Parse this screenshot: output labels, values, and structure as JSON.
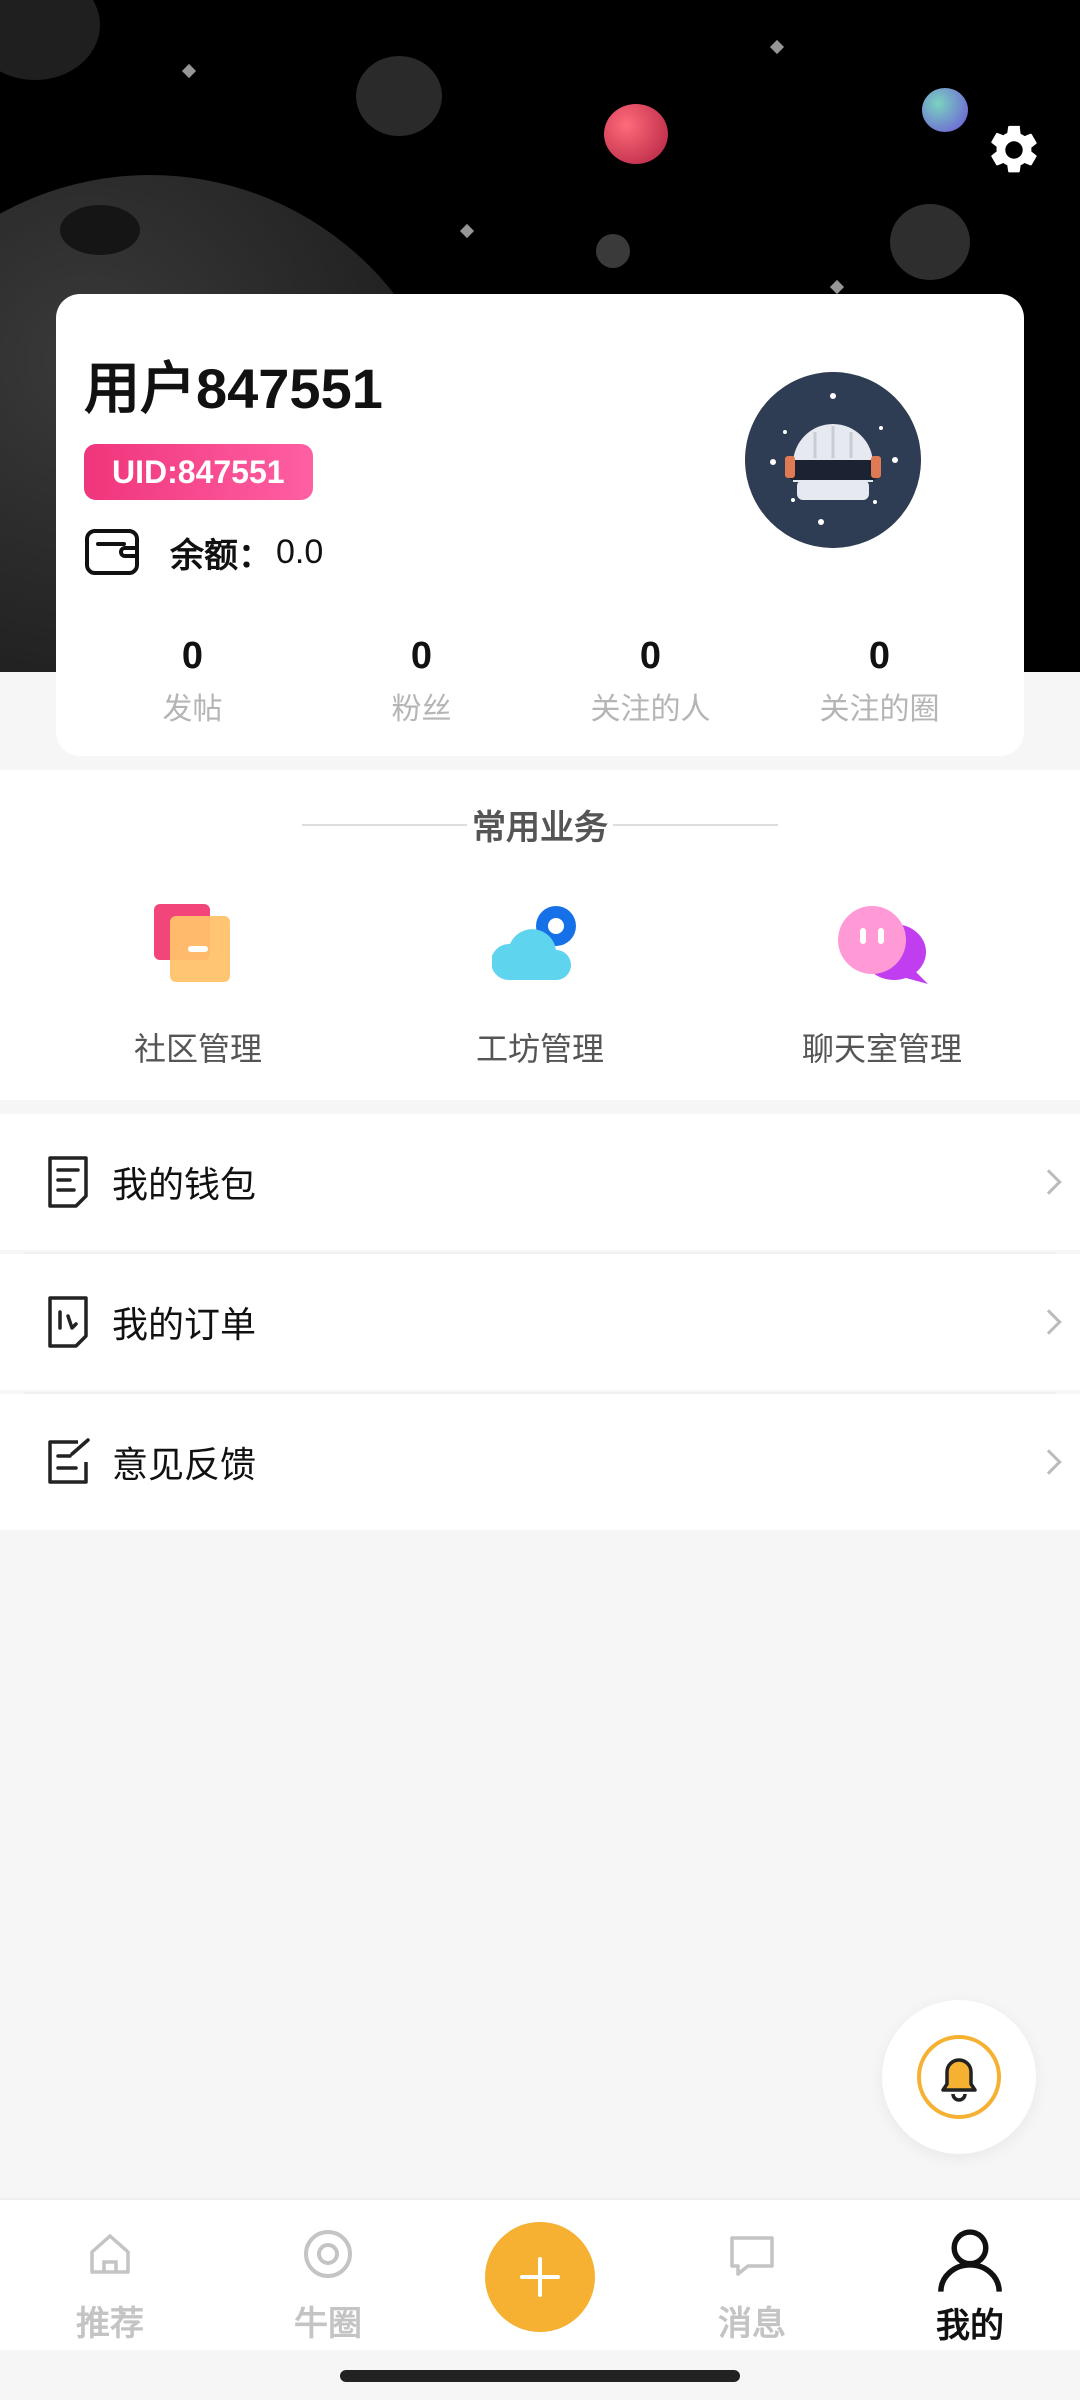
{
  "header": {
    "settings_icon": "gear-icon"
  },
  "profile": {
    "username": "用户847551",
    "uid": "UID:847551",
    "balance_label": "余额：",
    "balance_value": "0.0",
    "avatar_icon": "astronaut-avatar",
    "stats": [
      {
        "value": "0",
        "label": "发帖"
      },
      {
        "value": "0",
        "label": "粉丝"
      },
      {
        "value": "0",
        "label": "关注的人"
      },
      {
        "value": "0",
        "label": "关注的圈"
      }
    ]
  },
  "services": {
    "title": "常用业务",
    "items": [
      {
        "label": "社区管理",
        "icon": "community-icon"
      },
      {
        "label": "工坊管理",
        "icon": "workshop-cloud-gear-icon"
      },
      {
        "label": "聊天室管理",
        "icon": "chat-bubbles-icon"
      }
    ]
  },
  "menu": [
    {
      "label": "我的钱包",
      "icon": "wallet-doc-icon"
    },
    {
      "label": "我的订单",
      "icon": "order-doc-icon"
    },
    {
      "label": "意见反馈",
      "icon": "feedback-edit-icon"
    }
  ],
  "fab": {
    "icon": "bell-icon"
  },
  "bottom_nav": {
    "items": [
      {
        "label": "推荐",
        "icon": "home-icon"
      },
      {
        "label": "牛圈",
        "icon": "circle-icon"
      },
      {
        "label": "",
        "icon": "plus-icon"
      },
      {
        "label": "消息",
        "icon": "message-icon"
      },
      {
        "label": "我的",
        "icon": "user-icon",
        "active": true
      }
    ]
  },
  "colors": {
    "accent": "#f6b032",
    "uid_badge": "#f0357b",
    "avatar_bg": "#2f3d54"
  }
}
